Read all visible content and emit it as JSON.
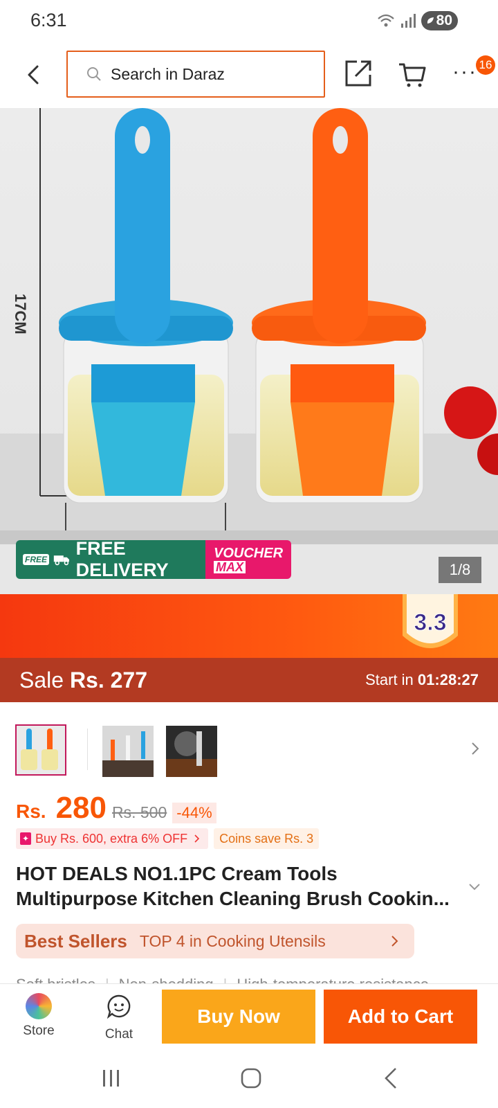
{
  "status_bar": {
    "time": "6:31",
    "battery": "80"
  },
  "header": {
    "search_placeholder": "Search in Daraz",
    "notification_count": "16"
  },
  "product_image": {
    "dimension_label": "17CM",
    "free_tag": "FREE",
    "delivery_text": "FREE DELIVERY",
    "voucher_line1": "VOUCHER",
    "voucher_line2": "MAX",
    "page_indicator": "1/8"
  },
  "campaign": {
    "logo_text": "3.3",
    "sale_label": "Sale",
    "sale_price": "Rs. 277",
    "start_label": "Start in",
    "countdown": "01:28:27"
  },
  "thumbnails": [
    {
      "name": "blue-orange-brushes",
      "active": true
    },
    {
      "name": "three-brushes",
      "active": false
    },
    {
      "name": "grill-brush",
      "active": false
    }
  ],
  "price": {
    "prefix": "Rs.",
    "current": "280",
    "original": "Rs. 500",
    "discount": "-44%"
  },
  "promos": {
    "buy_more": "Buy Rs. 600, extra 6% OFF",
    "coins": "Coins save Rs. 3"
  },
  "product": {
    "title": "HOT DEALS NO1.1PC Cream Tools Multipurpose Kitchen Cleaning Brush Cookin..."
  },
  "best_sellers": {
    "title": "Best Sellers",
    "rank": "TOP 4 in Cooking Utensils"
  },
  "features": [
    "Soft bristles",
    "Non-shedding",
    "High-temperature resistance"
  ],
  "action_bar": {
    "store_label": "Store",
    "chat_label": "Chat",
    "buy_now_label": "Buy Now",
    "add_to_cart_label": "Add to Cart"
  },
  "colors": {
    "brand_orange": "#f85606",
    "buy_now_yellow": "#faa61a",
    "sale_bar": "#b33a22",
    "delivery_green": "#1f7a5c",
    "voucher_pink": "#e8186b"
  }
}
